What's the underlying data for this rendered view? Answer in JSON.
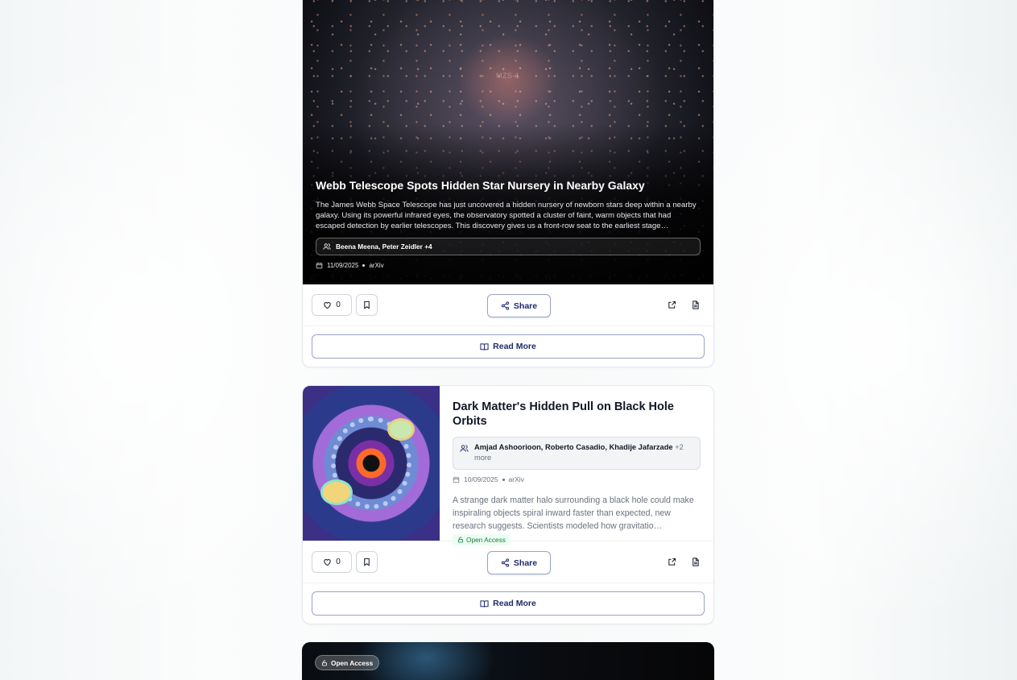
{
  "cards": [
    {
      "title": "Webb Telescope Spots Hidden Star Nursery in Nearby Galaxy",
      "image_label": "MZS-1",
      "summary": "The James Webb Space Telescope has just uncovered a hidden nursery of newborn stars deep within a nearby galaxy. Using its powerful infrared eyes, the observatory spotted a cluster of faint, warm objects that had escaped detection by earlier telescopes. This discovery gives us a front-row seat to the earliest stage…",
      "authors": "Beena Meena, Peter Zeidler +4",
      "date": "11/09/2025",
      "source": "arXiv",
      "likes": "0",
      "share_label": "Share",
      "read_more_label": "Read More"
    },
    {
      "title": "Dark Matter's Hidden Pull on Black Hole Orbits",
      "authors": "Amjad Ashoorioon, Roberto Casadio, Khadije Jafarzade",
      "authors_more": "+2 more",
      "date": "10/09/2025",
      "source": "arXiv",
      "summary": "A strange dark matter halo surrounding a black hole could make inspiraling objects spiral inward faster than expected, new research suggests. Scientists modeled how gravitatio…",
      "access_badge": "Open Access",
      "likes": "0",
      "share_label": "Share",
      "read_more_label": "Read More"
    },
    {
      "access_badge": "Open Access"
    }
  ],
  "icons": {
    "like": "heart-icon",
    "bookmark": "bookmark-icon",
    "share": "share-icon",
    "external": "external-link-icon",
    "document": "document-icon",
    "book": "book-open-icon",
    "users": "users-icon",
    "calendar": "calendar-icon",
    "lock": "lock-open-icon"
  },
  "colors": {
    "accent": "#1e2a6b",
    "open_access_text": "#15803d",
    "open_access_bg": "#ecfdf3"
  }
}
